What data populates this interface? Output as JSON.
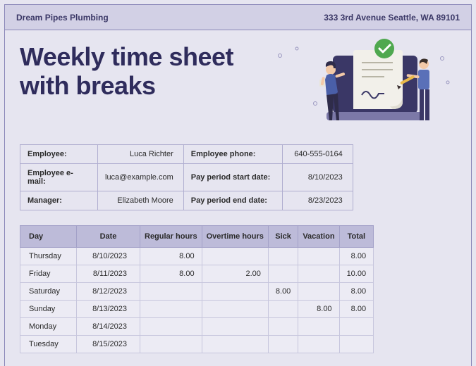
{
  "header": {
    "company": "Dream Pipes Plumbing",
    "address": "333 3rd Avenue Seattle, WA 89101"
  },
  "title_line1": "Weekly time sheet",
  "title_line2": "with breaks",
  "info": {
    "employee_label": "Employee:",
    "employee_value": "Luca Richter",
    "phone_label": "Employee phone:",
    "phone_value": "640-555-0164",
    "email_label": "Employee e-mail:",
    "email_value": "luca@example.com",
    "start_label": "Pay period start date:",
    "start_value": "8/10/2023",
    "manager_label": "Manager:",
    "manager_value": "Elizabeth Moore",
    "end_label": "Pay period end date:",
    "end_value": "8/23/2023"
  },
  "columns": {
    "day": "Day",
    "date": "Date",
    "regular": "Regular hours",
    "overtime": "Overtime hours",
    "sick": "Sick",
    "vacation": "Vacation",
    "total": "Total"
  },
  "rows": [
    {
      "day": "Thursday",
      "date": "8/10/2023",
      "regular": "8.00",
      "overtime": "",
      "sick": "",
      "vacation": "",
      "total": "8.00"
    },
    {
      "day": "Friday",
      "date": "8/11/2023",
      "regular": "8.00",
      "overtime": "2.00",
      "sick": "",
      "vacation": "",
      "total": "10.00"
    },
    {
      "day": "Saturday",
      "date": "8/12/2023",
      "regular": "",
      "overtime": "",
      "sick": "8.00",
      "vacation": "",
      "total": "8.00"
    },
    {
      "day": "Sunday",
      "date": "8/13/2023",
      "regular": "",
      "overtime": "",
      "sick": "",
      "vacation": "8.00",
      "total": "8.00"
    },
    {
      "day": "Monday",
      "date": "8/14/2023",
      "regular": "",
      "overtime": "",
      "sick": "",
      "vacation": "",
      "total": ""
    },
    {
      "day": "Tuesday",
      "date": "8/15/2023",
      "regular": "",
      "overtime": "",
      "sick": "",
      "vacation": "",
      "total": ""
    }
  ]
}
